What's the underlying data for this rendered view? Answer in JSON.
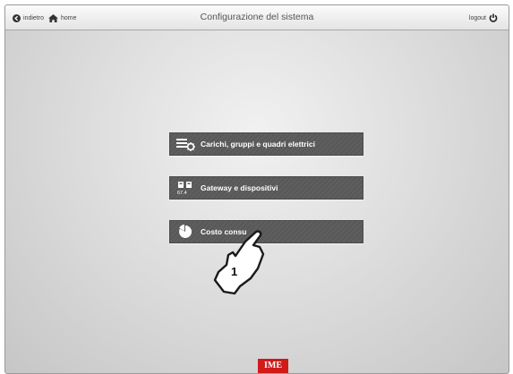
{
  "topbar": {
    "back_label": "indietro",
    "home_label": "home",
    "title": "Configurazione del sistema",
    "logout_label": "logout"
  },
  "menu": {
    "items": [
      {
        "label": "Carichi, gruppi e quadri elettrici",
        "icon": "load-groups-icon"
      },
      {
        "label": "Gateway e dispositivi",
        "icon": "gateway-icon"
      },
      {
        "label": "Costo consu",
        "icon": "pie-chart-icon"
      }
    ]
  },
  "annotation": {
    "step_number": "1",
    "icon": "pointing-hand-icon"
  },
  "brand": {
    "logo_text": "IME",
    "color": "#d11a1a"
  },
  "colors": {
    "button_bg": "#5f5f5f",
    "button_text": "#ffffff"
  }
}
